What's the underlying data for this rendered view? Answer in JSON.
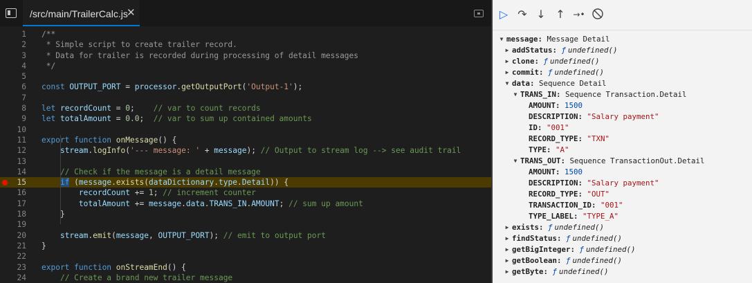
{
  "editor": {
    "tab_title": "/src/main/TrailerCalc.js",
    "close_glyph": "✕",
    "active_line": 15,
    "breakpoint_line": 15,
    "lines": [
      {
        "n": "1",
        "t": [
          [
            "cm",
            "/**"
          ]
        ]
      },
      {
        "n": "2",
        "t": [
          [
            "cm",
            " * Simple script to create trailer record."
          ]
        ]
      },
      {
        "n": "3",
        "t": [
          [
            "cm",
            " * Data for trailer is recorded during processing of detail messages"
          ]
        ]
      },
      {
        "n": "4",
        "t": [
          [
            "cm",
            " */"
          ]
        ]
      },
      {
        "n": "5",
        "t": []
      },
      {
        "n": "6",
        "t": [
          [
            "k",
            "const "
          ],
          [
            "v",
            "OUTPUT_PORT"
          ],
          [
            "o",
            " = "
          ],
          [
            "v",
            "processor"
          ],
          [
            "o",
            "."
          ],
          [
            "f",
            "getOutputPort"
          ],
          [
            "o",
            "("
          ],
          [
            "s",
            "'Output-1'"
          ],
          [
            "o",
            ");"
          ]
        ]
      },
      {
        "n": "7",
        "t": []
      },
      {
        "n": "8",
        "t": [
          [
            "k",
            "let "
          ],
          [
            "v",
            "recordCount"
          ],
          [
            "o",
            " = "
          ],
          [
            "n",
            "0"
          ],
          [
            "o",
            ";    "
          ],
          [
            "c",
            "// var to count records"
          ]
        ]
      },
      {
        "n": "9",
        "t": [
          [
            "k",
            "let "
          ],
          [
            "v",
            "totalAmount"
          ],
          [
            "o",
            " = "
          ],
          [
            "n",
            "0.0"
          ],
          [
            "o",
            ";  "
          ],
          [
            "c",
            "// var to sum up contained amounts"
          ]
        ]
      },
      {
        "n": "10",
        "t": []
      },
      {
        "n": "11",
        "t": [
          [
            "k",
            "export "
          ],
          [
            "k",
            "function "
          ],
          [
            "f",
            "onMessage"
          ],
          [
            "o",
            "() {"
          ]
        ]
      },
      {
        "n": "12",
        "t": [
          [
            "o",
            "    "
          ],
          [
            "v",
            "stream"
          ],
          [
            "o",
            "."
          ],
          [
            "f",
            "logInfo"
          ],
          [
            "o",
            "("
          ],
          [
            "s",
            "'--- message: '"
          ],
          [
            "o",
            " + "
          ],
          [
            "v",
            "message"
          ],
          [
            "o",
            "); "
          ],
          [
            "c",
            "// Output to stream log --> see audit trail"
          ]
        ]
      },
      {
        "n": "13",
        "t": []
      },
      {
        "n": "14",
        "t": [
          [
            "o",
            "    "
          ],
          [
            "c",
            "// Check if the message is a detail message"
          ]
        ]
      },
      {
        "n": "15",
        "t": [
          [
            "o",
            "    "
          ],
          [
            "hl",
            "if"
          ],
          [
            "o",
            " ("
          ],
          [
            "v",
            "message"
          ],
          [
            "o",
            "."
          ],
          [
            "f",
            "exists"
          ],
          [
            "o",
            "("
          ],
          [
            "v",
            "dataDictionary"
          ],
          [
            "o",
            "."
          ],
          [
            "v",
            "type"
          ],
          [
            "o",
            "."
          ],
          [
            "v",
            "Detail"
          ],
          [
            "o",
            ")) {"
          ]
        ]
      },
      {
        "n": "16",
        "t": [
          [
            "o",
            "        "
          ],
          [
            "v",
            "recordCount"
          ],
          [
            "o",
            " += "
          ],
          [
            "n",
            "1"
          ],
          [
            "o",
            "; "
          ],
          [
            "c",
            "// increment counter"
          ]
        ]
      },
      {
        "n": "17",
        "t": [
          [
            "o",
            "        "
          ],
          [
            "v",
            "totalAmount"
          ],
          [
            "o",
            " += "
          ],
          [
            "v",
            "message"
          ],
          [
            "o",
            "."
          ],
          [
            "v",
            "data"
          ],
          [
            "o",
            "."
          ],
          [
            "v",
            "TRANS_IN"
          ],
          [
            "o",
            "."
          ],
          [
            "v",
            "AMOUNT"
          ],
          [
            "o",
            "; "
          ],
          [
            "c",
            "// sum up amount"
          ]
        ]
      },
      {
        "n": "18",
        "t": [
          [
            "o",
            "    }"
          ]
        ]
      },
      {
        "n": "19",
        "t": []
      },
      {
        "n": "20",
        "t": [
          [
            "o",
            "    "
          ],
          [
            "v",
            "stream"
          ],
          [
            "o",
            "."
          ],
          [
            "f",
            "emit"
          ],
          [
            "o",
            "("
          ],
          [
            "v",
            "message"
          ],
          [
            "o",
            ", "
          ],
          [
            "v",
            "OUTPUT_PORT"
          ],
          [
            "o",
            "); "
          ],
          [
            "c",
            "// emit to output port"
          ]
        ]
      },
      {
        "n": "21",
        "t": [
          [
            "o",
            "}"
          ]
        ]
      },
      {
        "n": "22",
        "t": []
      },
      {
        "n": "23",
        "t": [
          [
            "k",
            "export "
          ],
          [
            "k",
            "function "
          ],
          [
            "f",
            "onStreamEnd"
          ],
          [
            "o",
            "() {"
          ]
        ]
      },
      {
        "n": "24",
        "t": [
          [
            "o",
            "    "
          ],
          [
            "c",
            "// Create a brand new trailer message"
          ]
        ]
      }
    ]
  },
  "debug": {
    "toolbar": {
      "continue": "▷",
      "step_over": "↷",
      "step_into": "↓",
      "step_out": "↑",
      "run_to_cursor": "→•",
      "deactivate": "⃠"
    },
    "tree": [
      {
        "depth": 0,
        "twist": "▼",
        "key": "message:",
        "val": " Message Detail",
        "kind": "type"
      },
      {
        "depth": 1,
        "twist": "▶",
        "key": "addStatus:",
        "val": "undefined()",
        "kind": "fn",
        "fsym": "ƒ"
      },
      {
        "depth": 1,
        "twist": "▶",
        "key": "clone:",
        "val": "undefined()",
        "kind": "fn",
        "fsym": "ƒ"
      },
      {
        "depth": 1,
        "twist": "▶",
        "key": "commit:",
        "val": "undefined()",
        "kind": "fn",
        "fsym": "ƒ"
      },
      {
        "depth": 1,
        "twist": "▼",
        "key": "data:",
        "val": " Sequence Detail",
        "kind": "type"
      },
      {
        "depth": 2,
        "twist": "▼",
        "key": "TRANS_IN:",
        "val": " Sequence Transaction.Detail",
        "kind": "type"
      },
      {
        "depth": 3,
        "twist": "",
        "key": "AMOUNT:",
        "val": " 1500",
        "kind": "num"
      },
      {
        "depth": 3,
        "twist": "",
        "key": "DESCRIPTION:",
        "val": " \"Salary payment\"",
        "kind": "str"
      },
      {
        "depth": 3,
        "twist": "",
        "key": "ID:",
        "val": " \"001\"",
        "kind": "str"
      },
      {
        "depth": 3,
        "twist": "",
        "key": "RECORD_TYPE:",
        "val": " \"TXN\"",
        "kind": "str"
      },
      {
        "depth": 3,
        "twist": "",
        "key": "TYPE:",
        "val": " \"A\"",
        "kind": "str"
      },
      {
        "depth": 2,
        "twist": "▼",
        "key": "TRANS_OUT:",
        "val": " Sequence TransactionOut.Detail",
        "kind": "type"
      },
      {
        "depth": 3,
        "twist": "",
        "key": "AMOUNT:",
        "val": " 1500",
        "kind": "num"
      },
      {
        "depth": 3,
        "twist": "",
        "key": "DESCRIPTION:",
        "val": " \"Salary payment\"",
        "kind": "str"
      },
      {
        "depth": 3,
        "twist": "",
        "key": "RECORD_TYPE:",
        "val": " \"OUT\"",
        "kind": "str"
      },
      {
        "depth": 3,
        "twist": "",
        "key": "TRANSACTION_ID:",
        "val": " \"001\"",
        "kind": "str"
      },
      {
        "depth": 3,
        "twist": "",
        "key": "TYPE_LABEL:",
        "val": " \"TYPE_A\"",
        "kind": "str"
      },
      {
        "depth": 1,
        "twist": "▶",
        "key": "exists:",
        "val": "undefined()",
        "kind": "fn",
        "fsym": "ƒ"
      },
      {
        "depth": 1,
        "twist": "▶",
        "key": "findStatus:",
        "val": "undefined()",
        "kind": "fn",
        "fsym": "ƒ"
      },
      {
        "depth": 1,
        "twist": "▶",
        "key": "getBigInteger:",
        "val": "undefined()",
        "kind": "fn",
        "fsym": "ƒ"
      },
      {
        "depth": 1,
        "twist": "▶",
        "key": "getBoolean:",
        "val": "undefined()",
        "kind": "fn",
        "fsym": "ƒ"
      },
      {
        "depth": 1,
        "twist": "▶",
        "key": "getByte:",
        "val": "undefined()",
        "kind": "fn",
        "fsym": "ƒ"
      }
    ]
  }
}
